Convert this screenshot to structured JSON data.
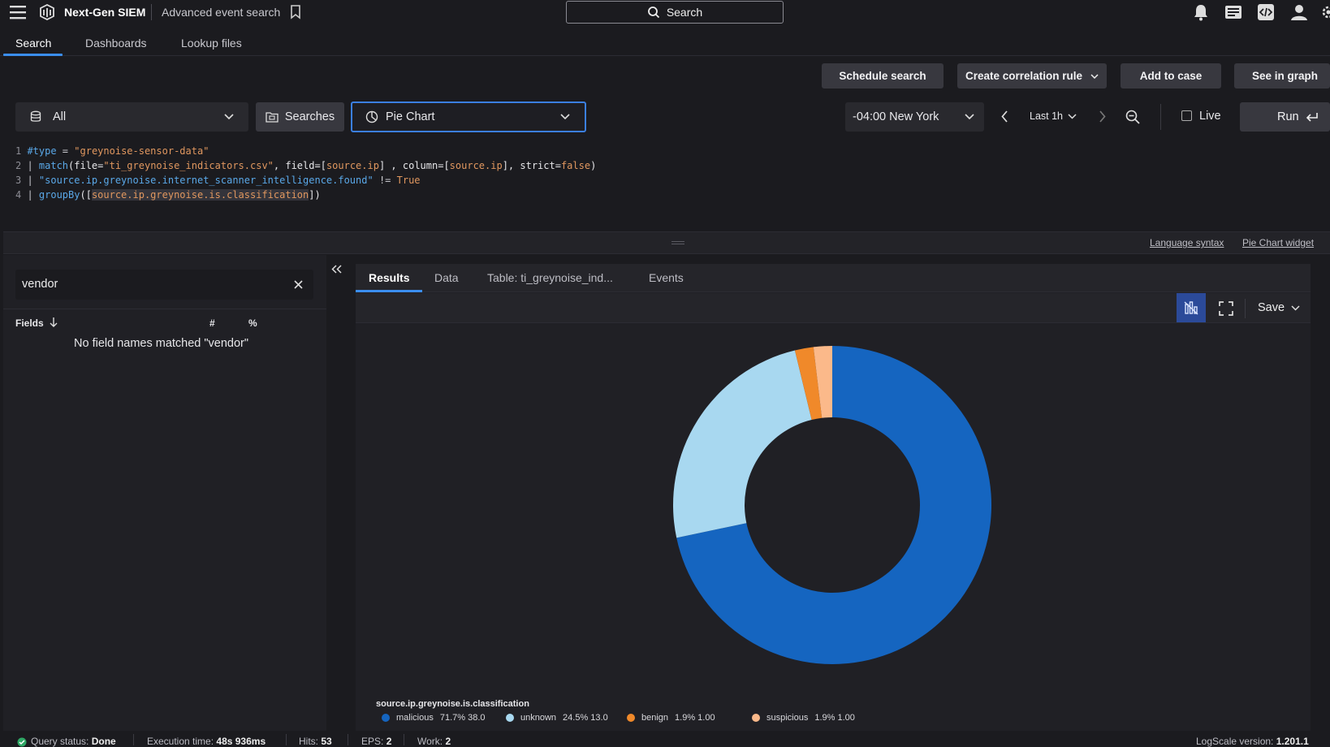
{
  "app": {
    "title": "Next-Gen SIEM",
    "page_title": "Advanced event search",
    "search_label": "Search"
  },
  "nav_tabs": [
    {
      "label": "Search",
      "active": true
    },
    {
      "label": "Dashboards",
      "active": false
    },
    {
      "label": "Lookup files",
      "active": false
    }
  ],
  "toolbar": {
    "schedule_search": "Schedule search",
    "create_correlation_rule": "Create correlation rule",
    "add_to_case": "Add to case",
    "see_in_graph": "See in graph"
  },
  "query_bar": {
    "repo_value": "All",
    "searches_label": "Searches",
    "widget_value": "Pie Chart",
    "timezone_value": "-04:00 New York",
    "time_range": "Last 1h",
    "live_label": "Live",
    "live_checked": false,
    "run_label": "Run"
  },
  "query_lines": [
    {
      "n": "1",
      "tokens": [
        {
          "t": "#type",
          "c": "kw"
        },
        {
          "t": " = ",
          "c": "op"
        },
        {
          "t": "\"greynoise-sensor-data\"",
          "c": "str"
        }
      ]
    },
    {
      "n": "2",
      "tokens": [
        {
          "t": "| ",
          "c": "op"
        },
        {
          "t": "match",
          "c": "kw"
        },
        {
          "t": "(file=",
          "c": "pl"
        },
        {
          "t": "\"ti_greynoise_indicators.csv\"",
          "c": "str"
        },
        {
          "t": ", field=[",
          "c": "pl"
        },
        {
          "t": "source.ip",
          "c": "str"
        },
        {
          "t": "] , column=[",
          "c": "pl"
        },
        {
          "t": "source.ip",
          "c": "str"
        },
        {
          "t": "], strict=",
          "c": "pl"
        },
        {
          "t": "false",
          "c": "str"
        },
        {
          "t": ")",
          "c": "pl"
        }
      ]
    },
    {
      "n": "3",
      "tokens": [
        {
          "t": "| ",
          "c": "op"
        },
        {
          "t": "\"source.ip.greynoise.internet_scanner_intelligence.found\"",
          "c": "kw"
        },
        {
          "t": " != ",
          "c": "op"
        },
        {
          "t": "True",
          "c": "str"
        }
      ]
    },
    {
      "n": "4",
      "tokens": [
        {
          "t": "| ",
          "c": "op"
        },
        {
          "t": "groupBy",
          "c": "kw"
        },
        {
          "t": "([",
          "c": "pl"
        },
        {
          "t": "source.ip.greynoise.is.classification",
          "c": "str"
        },
        {
          "t": "])",
          "c": "pl"
        }
      ]
    }
  ],
  "editor_links": {
    "language_syntax": "Language syntax",
    "widget_help": "Pie Chart widget"
  },
  "fields_panel": {
    "filter_value": "vendor",
    "fields_header": "Fields",
    "count_header": "#",
    "percent_header": "%",
    "empty_message": "No field names matched \"vendor\""
  },
  "result_tabs": [
    {
      "label": "Results",
      "active": true
    },
    {
      "label": "Data",
      "active": false
    },
    {
      "label": "Table: ti_greynoise_ind...",
      "active": false
    },
    {
      "label": "Events",
      "active": false
    }
  ],
  "widget_toolbar": {
    "save_label": "Save"
  },
  "chart_data": {
    "type": "pie",
    "donut": true,
    "legend_title": "source.ip.greynoise.is.classification",
    "legend_position": "bottom-left",
    "slices": [
      {
        "name": "malicious",
        "percent": "71.7%",
        "value": 38.0,
        "count_label": "38.0",
        "color": "#1565c0"
      },
      {
        "name": "unknown",
        "percent": "24.5%",
        "value": 13.0,
        "count_label": "13.0",
        "color": "#a8d8f0"
      },
      {
        "name": "benign",
        "percent": "1.9%",
        "value": 1.0,
        "count_label": "1.00",
        "color": "#f0892a"
      },
      {
        "name": "suspicious",
        "percent": "1.9%",
        "value": 1.0,
        "count_label": "1.00",
        "color": "#fbb98a"
      }
    ]
  },
  "status_bar": {
    "query_status_label": "Query status:",
    "query_status_value": "Done",
    "execution_label": "Execution time:",
    "execution_value": "48s 936ms",
    "hits_label": "Hits:",
    "hits_value": "53",
    "eps_label": "EPS:",
    "eps_value": "2",
    "work_label": "Work:",
    "work_value": "2",
    "version_label": "LogScale version:",
    "version_value": "1.201.1"
  }
}
